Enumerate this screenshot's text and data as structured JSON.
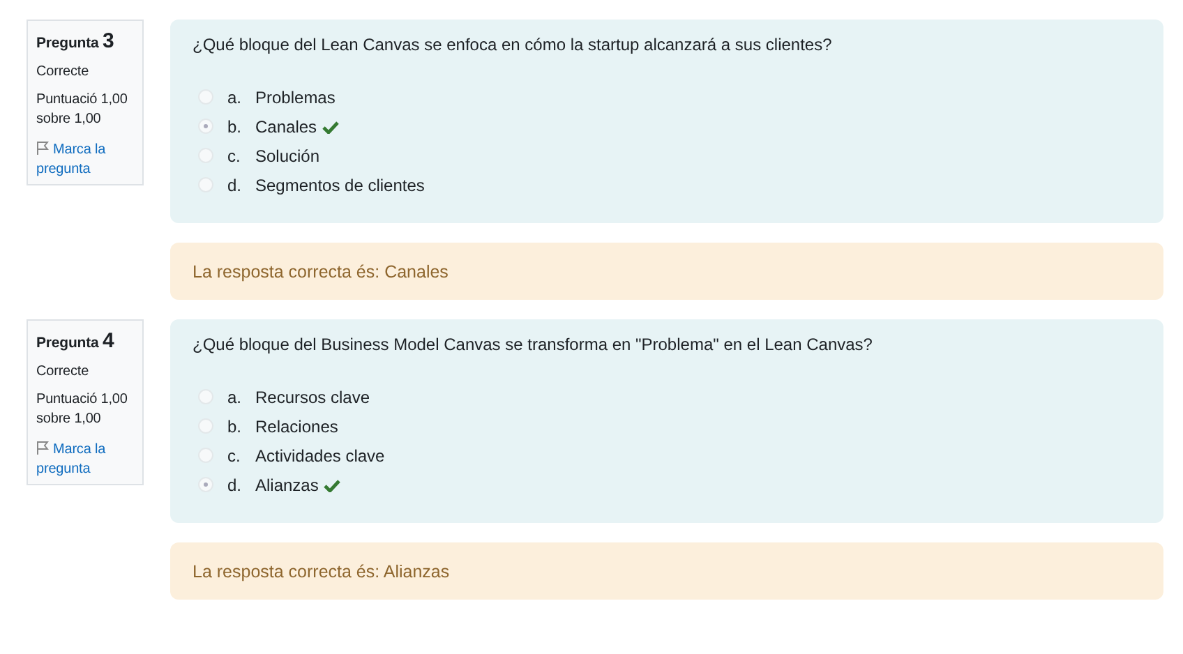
{
  "questions": [
    {
      "label": "Pregunta",
      "number": "3",
      "state": "Correcte",
      "grade": "Puntuació 1,00 sobre 1,00",
      "flag": "Marca la pregunta",
      "text": "¿Qué bloque del Lean Canvas se enfoca en cómo la startup alcanzará a sus clientes?",
      "options": [
        {
          "letter": "a.",
          "text": "Problemas",
          "selected": false,
          "correct": false
        },
        {
          "letter": "b.",
          "text": "Canales",
          "selected": true,
          "correct": true
        },
        {
          "letter": "c.",
          "text": "Solución",
          "selected": false,
          "correct": false
        },
        {
          "letter": "d.",
          "text": "Segmentos de clientes",
          "selected": false,
          "correct": false
        }
      ],
      "feedback": "La resposta correcta és: Canales"
    },
    {
      "label": "Pregunta",
      "number": "4",
      "state": "Correcte",
      "grade": "Puntuació 1,00 sobre 1,00",
      "flag": "Marca la pregunta",
      "text": "¿Qué bloque del Business Model Canvas se transforma en \"Problema\" en el Lean Canvas?",
      "options": [
        {
          "letter": "a.",
          "text": "Recursos clave",
          "selected": false,
          "correct": false
        },
        {
          "letter": "b.",
          "text": "Relaciones",
          "selected": false,
          "correct": false
        },
        {
          "letter": "c.",
          "text": "Actividades clave",
          "selected": false,
          "correct": false
        },
        {
          "letter": "d.",
          "text": "Alianzas",
          "selected": true,
          "correct": true
        }
      ],
      "feedback": "La resposta correcta és: Alianzas"
    }
  ]
}
